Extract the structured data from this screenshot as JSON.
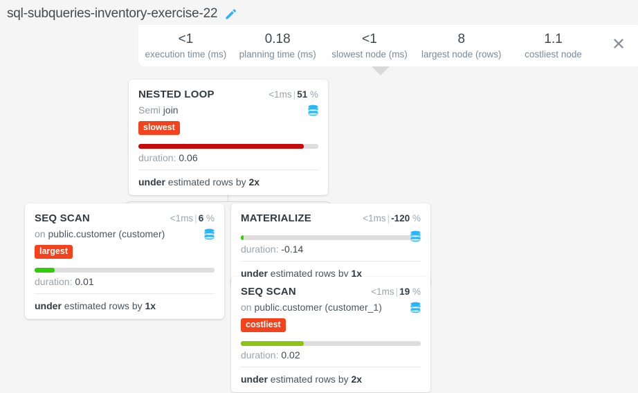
{
  "header": {
    "plan_title": "sql-subqueries-inventory-exercise-22",
    "edit_icon": "pencil-icon",
    "close_icon": "close-icon"
  },
  "stats": [
    {
      "value": "<1",
      "label": "execution time (ms)"
    },
    {
      "value": "0.18",
      "label": "planning time (ms)"
    },
    {
      "value": "<1",
      "label": "slowest node (ms)"
    },
    {
      "value": "8",
      "label": "largest node (rows)"
    },
    {
      "value": "1.1",
      "label": "costliest node"
    }
  ],
  "colors": {
    "page_bg": "#f5f5f5",
    "panel_bg": "#ffffff",
    "badge": "#f4431c",
    "bar_red": "#c40c0c",
    "bar_green": "#33cc0d",
    "bar_olive": "#8cc413",
    "bar_track": "#dedede",
    "icon_blue": "#29b6f6",
    "text_dark": "#36424a",
    "text_muted": "#9aa4ab"
  },
  "nodes": {
    "nested_loop": {
      "type": "NESTED LOOP",
      "time": "<1ms",
      "separator": "|",
      "percent": "51",
      "percent_unit": "%",
      "subtitle_prefix": "Semi",
      "subtitle_rest": "join",
      "badge": "slowest",
      "bar_color": "#c40c0c",
      "bar_pct": 92,
      "duration_label": "duration:",
      "duration_value": "0.06",
      "estimate_bold": "under",
      "estimate_text": "estimated rows by",
      "estimate_factor": "2x",
      "db_icon": "database-icon"
    },
    "seq_scan_left": {
      "type": "SEQ SCAN",
      "time": "<1ms",
      "separator": "|",
      "percent": "6",
      "percent_unit": "%",
      "subtitle_prefix": "on",
      "subtitle_rest": "public.customer (customer)",
      "badge": "largest",
      "bar_color": "#33cc0d",
      "bar_pct": 11,
      "duration_label": "duration:",
      "duration_value": "0.01",
      "estimate_bold": "under",
      "estimate_text": "estimated rows by",
      "estimate_factor": "1x",
      "db_icon": "database-icon"
    },
    "materialize": {
      "type": "MATERIALIZE",
      "time": "<1ms",
      "separator": "|",
      "percent": "-120",
      "percent_unit": "%",
      "bar_color": "#33cc0d",
      "bar_pct": 1.6,
      "duration_label": "duration:",
      "duration_value": "-0.14",
      "estimate_bold": "under",
      "estimate_text": "estimated rows by",
      "estimate_factor": "1x",
      "db_icon": "database-icon"
    },
    "seq_scan_bottom": {
      "type": "SEQ SCAN",
      "time": "<1ms",
      "separator": "|",
      "percent": "19",
      "percent_unit": "%",
      "subtitle_prefix": "on",
      "subtitle_rest": "public.customer (customer_1)",
      "badge": "costliest",
      "bar_color": "#8cc413",
      "bar_pct": 35,
      "duration_label": "duration:",
      "duration_value": "0.02",
      "estimate_bold": "under",
      "estimate_text": "estimated rows by",
      "estimate_factor": "2x",
      "db_icon": "database-icon"
    }
  }
}
